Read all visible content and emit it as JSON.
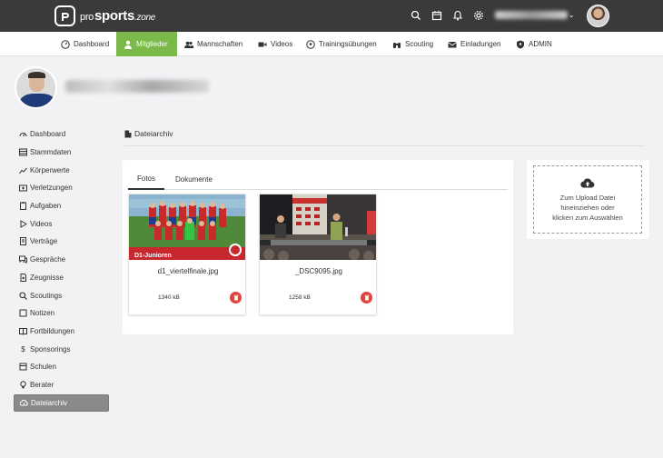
{
  "brand": {
    "pro": "pro",
    "sports": "sports",
    "zone": ".zone"
  },
  "top_icons": [
    "search-icon",
    "calendar-icon",
    "bell-icon",
    "gear-icon"
  ],
  "nav": [
    {
      "label": "Dashboard",
      "icon": "dashboard-icon",
      "active": false
    },
    {
      "label": "Mitglieder",
      "icon": "user-icon",
      "active": true
    },
    {
      "label": "Mannschaften",
      "icon": "users-icon",
      "active": false
    },
    {
      "label": "Videos",
      "icon": "video-icon",
      "active": false
    },
    {
      "label": "Trainingsübungen",
      "icon": "football-icon",
      "active": false
    },
    {
      "label": "Scouting",
      "icon": "binoculars-icon",
      "active": false
    },
    {
      "label": "Einladungen",
      "icon": "envelope-icon",
      "active": false
    },
    {
      "label": "ADMIN",
      "icon": "shield-icon",
      "active": false
    }
  ],
  "sidebar": {
    "items": [
      {
        "label": "Dashboard",
        "icon": "dashboard-icon"
      },
      {
        "label": "Stammdaten",
        "icon": "database-icon"
      },
      {
        "label": "Körperwerte",
        "icon": "chart-line-icon"
      },
      {
        "label": "Verletzungen",
        "icon": "medkit-icon"
      },
      {
        "label": "Aufgaben",
        "icon": "clipboard-icon"
      },
      {
        "label": "Videos",
        "icon": "play-icon"
      },
      {
        "label": "Verträge",
        "icon": "file-contract-icon"
      },
      {
        "label": "Gespräche",
        "icon": "comments-icon"
      },
      {
        "label": "Zeugnisse",
        "icon": "certificate-icon"
      },
      {
        "label": "Scoutings",
        "icon": "search-icon"
      },
      {
        "label": "Notizen",
        "icon": "note-icon"
      },
      {
        "label": "Fortbildungen",
        "icon": "book-icon"
      },
      {
        "label": "Sponsorings",
        "icon": "dollar-icon"
      },
      {
        "label": "Schulen",
        "icon": "school-icon"
      },
      {
        "label": "Berater",
        "icon": "lightbulb-icon"
      },
      {
        "label": "Dateiarchiv",
        "icon": "cloud-icon"
      }
    ],
    "active": "Dateiarchiv"
  },
  "content": {
    "title": "Dateiarchiv",
    "tabs": [
      {
        "label": "Fotos",
        "active": true
      },
      {
        "label": "Dokumente",
        "active": false
      }
    ],
    "photos": [
      {
        "name": "d1_viertelfinale.jpg",
        "size": "1340 kB",
        "caption": "D1-Junioren"
      },
      {
        "name": "_DSC9095.jpg",
        "size": "1258 kB"
      }
    ]
  },
  "upload": {
    "line1": "Zum Upload Datei",
    "line2": "hineinziehen oder",
    "line3": "klicken zum Auswählen"
  },
  "colors": {
    "accent": "#7bb94a",
    "topbar": "#3a3a3a",
    "danger": "#e0443e"
  }
}
